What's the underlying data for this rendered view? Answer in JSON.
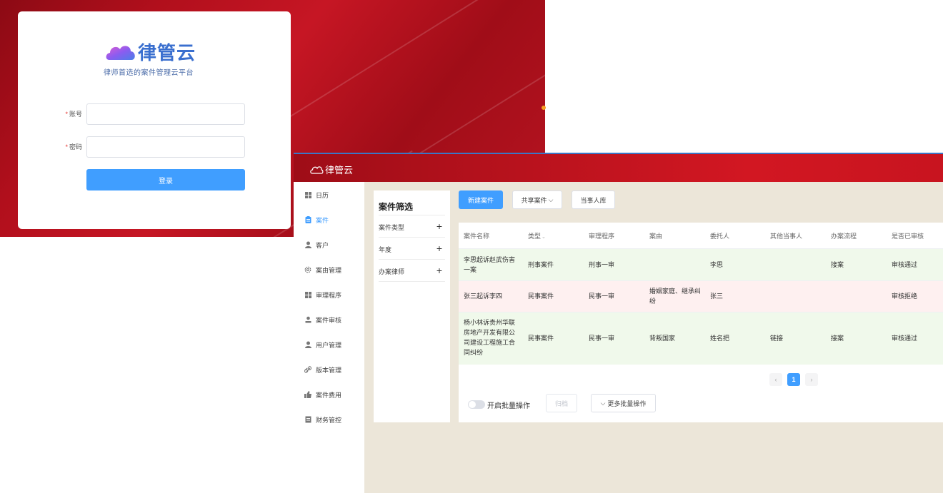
{
  "login": {
    "brand_name": "律管云",
    "slogan": "律师首选的案件管理云平台",
    "required_mark": "*",
    "account_label": "账号",
    "account_value": "",
    "password_label": "密码",
    "password_value": "",
    "submit_label": "登录"
  },
  "app": {
    "brand_name": "律管云",
    "sidebar": {
      "items": [
        {
          "label": "日历",
          "icon": "grid-icon"
        },
        {
          "label": "案件",
          "icon": "clipboard-icon",
          "active": true
        },
        {
          "label": "客户",
          "icon": "person-icon"
        },
        {
          "label": "案由管理",
          "icon": "gear-icon"
        },
        {
          "label": "审理程序",
          "icon": "grid-icon"
        },
        {
          "label": "案件审核",
          "icon": "user-check-icon"
        },
        {
          "label": "用户管理",
          "icon": "user-icon"
        },
        {
          "label": "版本管理",
          "icon": "link-icon"
        },
        {
          "label": "案件费用",
          "icon": "thumb-icon"
        },
        {
          "label": "财务管控",
          "icon": "ledger-icon"
        }
      ]
    },
    "filter": {
      "title": "案件筛选",
      "groups": [
        "案件类型",
        "年度",
        "办案律师"
      ],
      "expand_symbol": "+"
    },
    "toolbar": {
      "new_case": "新建案件",
      "shared_case": "共享案件",
      "party_library": "当事人库"
    },
    "table": {
      "columns": [
        "案件名称",
        "类型",
        "审理程序",
        "案由",
        "委托人",
        "其他当事人",
        "办案流程",
        "是否已审核"
      ],
      "rows": [
        {
          "name": "李思起诉赵武伤害一案",
          "type": "刑事案件",
          "procedure": "刑事一审",
          "cause": "",
          "client": "李思",
          "other_party": "",
          "flow": "接案",
          "review": "审核通过",
          "status": "pass"
        },
        {
          "name": "张三起诉李四",
          "type": "民事案件",
          "procedure": "民事一审",
          "cause": "婚姻家庭、继承纠纷",
          "client": "张三",
          "other_party": "",
          "flow": "",
          "review": "审核拒绝",
          "status": "reject"
        },
        {
          "name": "杨小林诉贵州华联房地产开发有限公司建设工程施工合同纠纷",
          "type": "民事案件",
          "procedure": "民事一审",
          "cause": "背叛国家",
          "client": "姓名把",
          "other_party": "链接",
          "flow": "接案",
          "review": "审核通过",
          "status": "pass"
        }
      ]
    },
    "pagination": {
      "prev": "‹",
      "current": "1",
      "next": "›"
    },
    "batch": {
      "toggle_label": "开启批量操作",
      "archive_label": "归档",
      "more_label": "更多批量操作"
    }
  },
  "colors": {
    "accent": "#409eff",
    "brand_red": "#c61624",
    "pass_row": "#f0f9eb",
    "reject_row": "#fef0f0"
  }
}
